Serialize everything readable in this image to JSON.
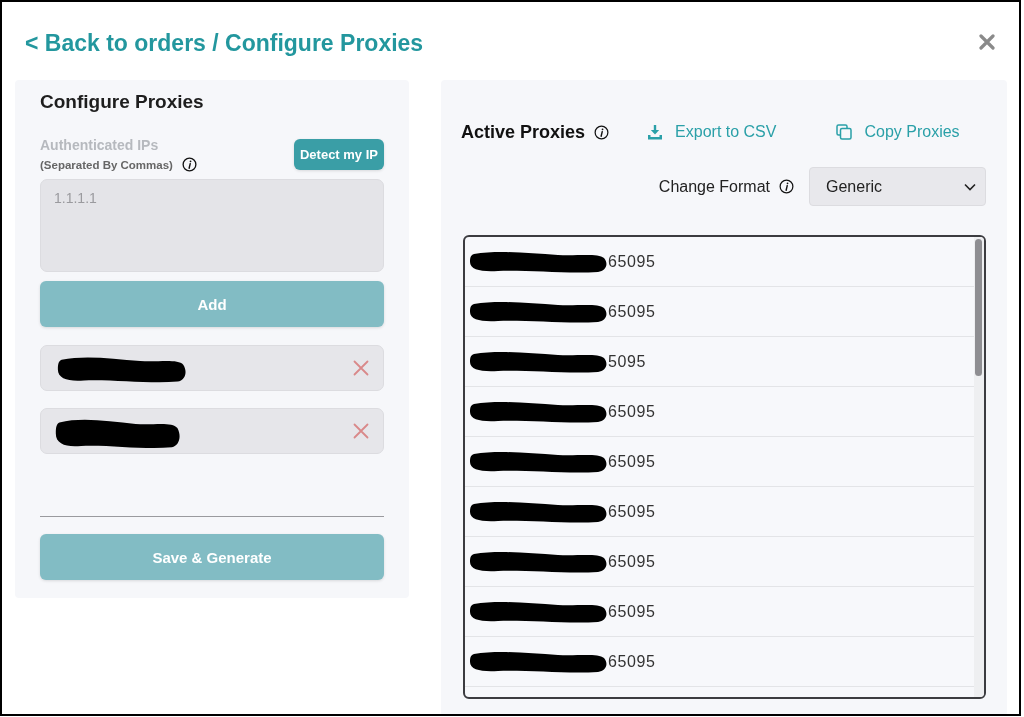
{
  "header": {
    "back_link": "< Back to orders / Configure Proxies"
  },
  "configure_panel": {
    "title": "Configure Proxies",
    "ips_field": {
      "label": "Authenticated IPs",
      "hint": "(Separated By Commas)",
      "placeholder": "1.1.1.1"
    },
    "detect_button": {
      "label": "Detect my IP",
      "disabled": false
    },
    "add_button": {
      "label": "Add",
      "disabled": true
    },
    "ips": [
      {
        "redacted": true
      },
      {
        "redacted": true
      }
    ],
    "save_button": {
      "label": "Save & Generate",
      "disabled": true
    }
  },
  "proxies_panel": {
    "title": "Active Proxies",
    "export_button": "Export to CSV",
    "copy_button": "Copy Proxies",
    "format_label": "Change Format",
    "format_select": {
      "value": "Generic"
    },
    "proxies": [
      {
        "text": "65095",
        "redacted": true
      },
      {
        "text": "65095",
        "redacted": true
      },
      {
        "text": "5095",
        "redacted": true
      },
      {
        "text": "65095",
        "redacted": true
      },
      {
        "text": "65095",
        "redacted": true
      },
      {
        "text": "65095",
        "redacted": true
      },
      {
        "text": "65095",
        "redacted": true
      },
      {
        "text": "65095",
        "redacted": true
      },
      {
        "text": "65095",
        "redacted": true
      }
    ]
  }
}
